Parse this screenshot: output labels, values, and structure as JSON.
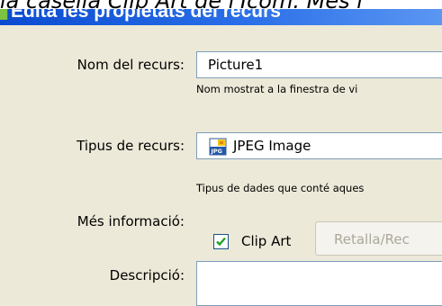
{
  "caption": {
    "text": "la casella Clip Art de l'Icom. Mes i"
  },
  "window": {
    "title": "Edita les propietats del recurs",
    "title_color": "#2a6fe8"
  },
  "form": {
    "name": {
      "label": "Nom del recurs:",
      "value": "Picture1",
      "hint": "Nom mostrat a la finestra de vi"
    },
    "type": {
      "label": "Tipus de recurs:",
      "value": "JPEG Image",
      "icon": "jpeg-file-icon",
      "hint": "Tipus de dades que conté aques"
    },
    "more_info": {
      "label": "Més informació:",
      "clip_art_label": "Clip Art",
      "clip_art_checked": true,
      "crop_button_label": "Retalla/Rec"
    },
    "description": {
      "label": "Descripció:",
      "value": ""
    }
  }
}
